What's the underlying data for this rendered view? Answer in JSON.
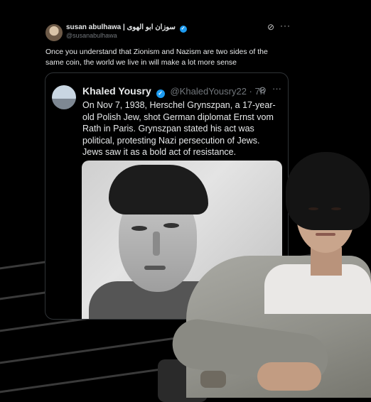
{
  "tweet": {
    "author_name": "susan abulhawa | سوزان ابو الهوى",
    "author_handle": "@susanabulhawa",
    "text": "Once you understand that Zionism and Nazism are two sides of the same coin, the world we live in will make a lot more sense",
    "icons": {
      "grok": "grok-icon",
      "more": "more-icon",
      "verified": "verified-badge-icon"
    }
  },
  "quote": {
    "author_name": "Khaled Yousry",
    "author_handle": "@KhaledYousry22 · 7h",
    "text": "On Nov 7, 1938, Herschel Grynszpan, a 17-year-old Polish Jew, shot German diplomat Ernst vom Rath in Paris. Grynszpan stated his act was political, protesting Nazi persecution of Jews. Jews saw it as a bold act of resistance."
  },
  "glyphs": {
    "verified": "✓",
    "grok": "⊘",
    "more": "···"
  },
  "colors": {
    "accent": "#1d9bf0",
    "text": "#e7e9ea",
    "muted": "#71767b",
    "background": "#000000"
  }
}
